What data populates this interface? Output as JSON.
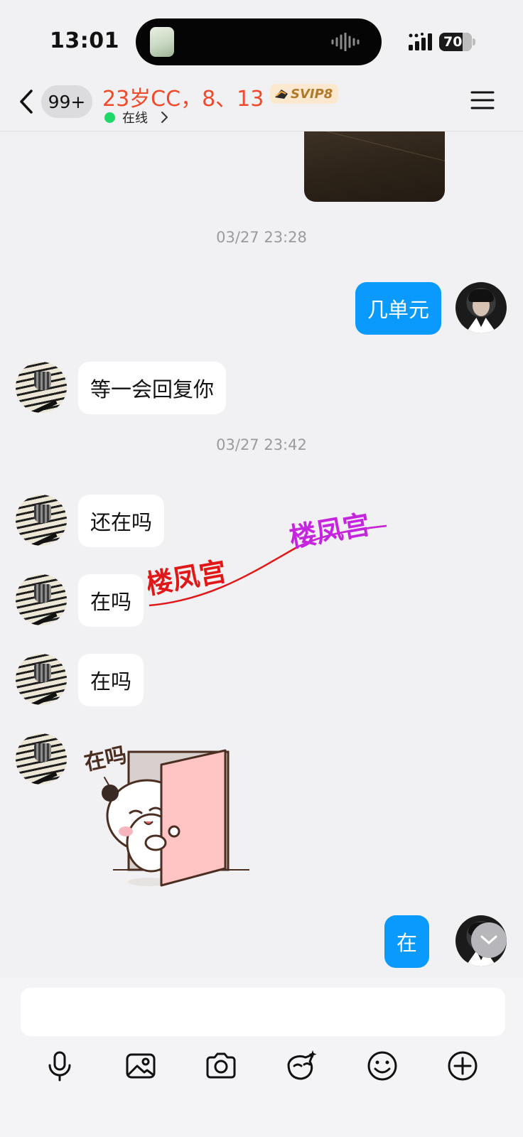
{
  "status_bar": {
    "time": "13:01",
    "battery": "70"
  },
  "header": {
    "unread_count": "99+",
    "title": "23岁CC，8、13",
    "vip_badge": "SVIP8",
    "presence": "在线"
  },
  "messages": [
    {
      "type": "image",
      "side": "out"
    },
    {
      "type": "timestamp",
      "text": "03/27 23:28"
    },
    {
      "type": "text",
      "side": "out",
      "text": "几单元"
    },
    {
      "type": "text",
      "side": "in",
      "text": "等一会回复你"
    },
    {
      "type": "timestamp",
      "text": "03/27 23:42"
    },
    {
      "type": "text",
      "side": "in",
      "text": "还在吗"
    },
    {
      "type": "text",
      "side": "in",
      "text": "在吗"
    },
    {
      "type": "text",
      "side": "in",
      "text": "在吗"
    },
    {
      "type": "sticker",
      "side": "in",
      "text": "在吗"
    },
    {
      "type": "text",
      "side": "out",
      "text": "在"
    }
  ],
  "overlay": {
    "watermark_1": "楼凤宫",
    "watermark_2": "楼凤宫"
  },
  "input": {
    "placeholder": ""
  },
  "toolbar": [
    "microphone-icon",
    "image-icon",
    "camera-icon",
    "red-packet-icon",
    "emoji-icon",
    "plus-icon"
  ],
  "colors": {
    "accent_blue": "#0a9afd",
    "title_red": "#f04a2a",
    "online_green": "#1fd86a",
    "background": "#f1f1f3"
  }
}
